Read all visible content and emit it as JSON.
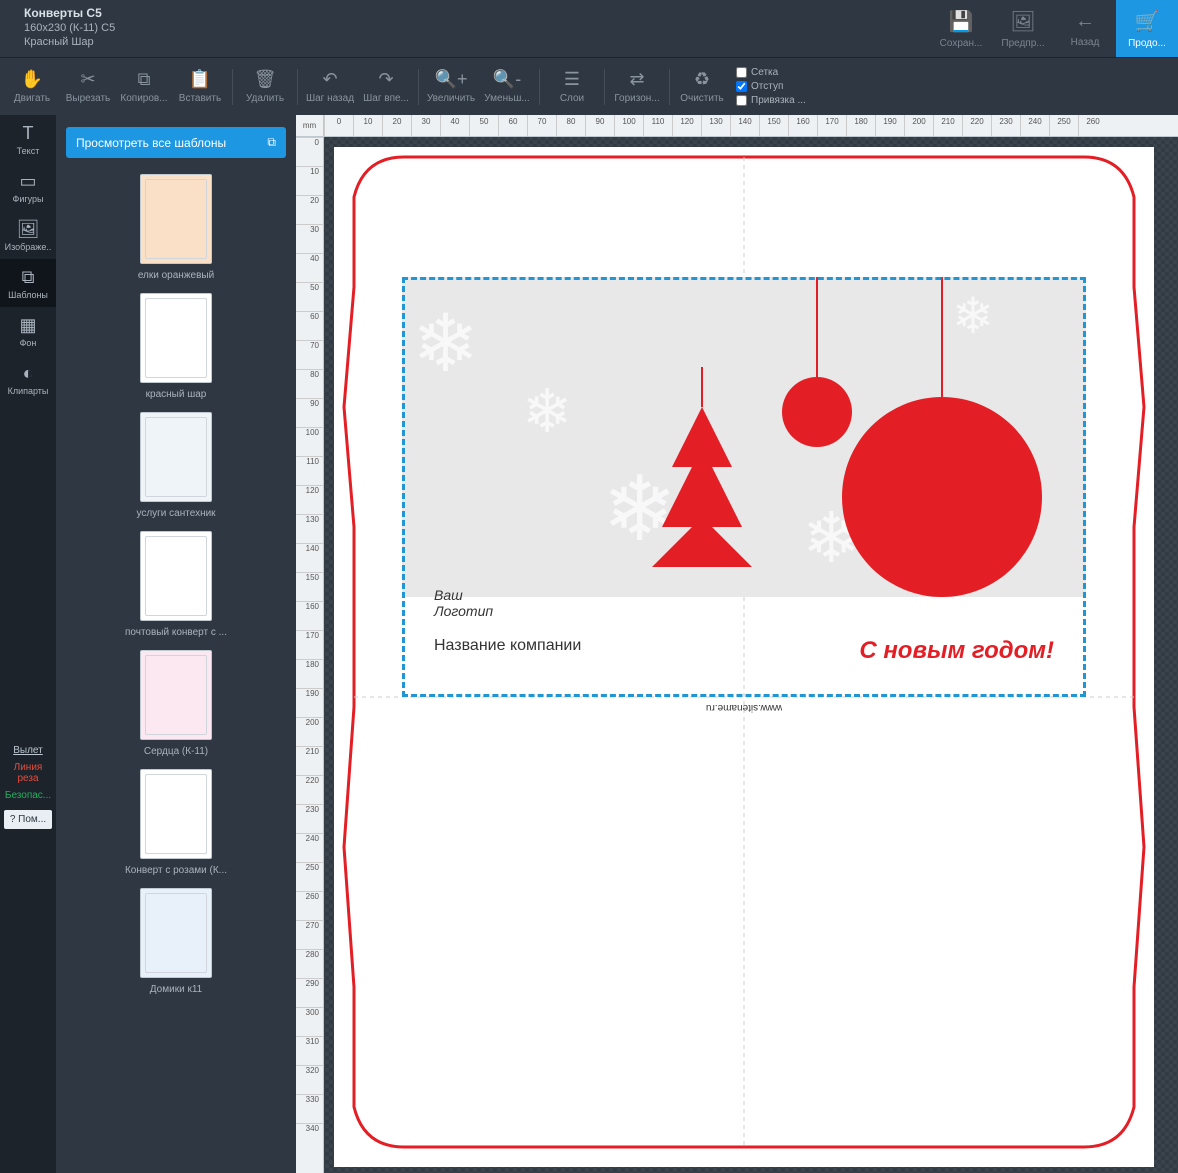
{
  "header": {
    "title": "Конверты С5",
    "sub1": "160x230 (К-11) С5",
    "sub2": "Красный Шар",
    "buttons": {
      "save": "Сохран...",
      "preview": "Предпр...",
      "back": "Назад",
      "continue": "Продо..."
    }
  },
  "toolbar": {
    "move": "Двигать",
    "cut": "Вырезать",
    "copy": "Копиров...",
    "paste": "Вставить",
    "delete": "Удалить",
    "undo": "Шаг назад",
    "redo": "Шаг впе...",
    "zoomIn": "Увеличить",
    "zoomOut": "Уменьш...",
    "layers": "Слои",
    "horizon": "Горизон...",
    "clear": "Очистить"
  },
  "viewOptions": {
    "grid": "Сетка",
    "margin": "Отступ",
    "snap": "Привязка ..."
  },
  "leftNav": {
    "text": "Текст",
    "shapes": "Фигуры",
    "images": "Изображе..",
    "templates": "Шаблоны",
    "background": "Фон",
    "cliparts": "Клипарты"
  },
  "smallLinks": {
    "bleed": "Вылет",
    "cutline": "Линия реза",
    "safe": "Безопас..."
  },
  "help": "? Пом...",
  "templatesPanel": {
    "browse": "Просмотреть все шаблоны",
    "items": [
      "елки оранжевый",
      "красный шар",
      "услуги сантехник",
      "почтовый конверт с ...",
      "Сердца (К-11)",
      "Конверт с розами (К...",
      "Домики к11"
    ]
  },
  "canvas": {
    "unit": "mm",
    "greeting": "С новым годом!",
    "logo": "Ваш\nЛоготип",
    "company": "Название компании",
    "site": "www.sitename.ru",
    "rulerH": [
      0,
      10,
      20,
      30,
      40,
      50,
      60,
      70,
      80,
      90,
      100,
      110,
      120,
      130,
      140,
      150,
      160,
      170,
      180,
      190,
      200,
      210,
      220,
      230,
      240,
      250,
      260
    ],
    "rulerV": [
      0,
      10,
      20,
      30,
      40,
      50,
      60,
      70,
      80,
      90,
      100,
      110,
      120,
      130,
      140,
      150,
      160,
      170,
      180,
      190,
      200,
      210,
      220,
      230,
      240,
      250,
      260,
      270,
      280,
      290,
      300,
      310,
      320,
      330,
      340
    ]
  }
}
